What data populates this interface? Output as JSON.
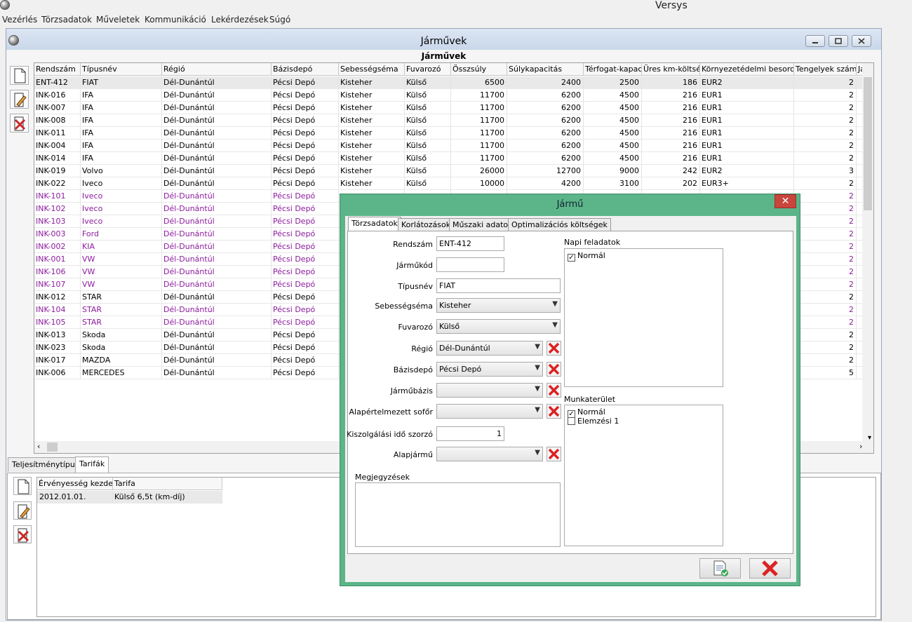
{
  "app": {
    "title": "Versys"
  },
  "menu": [
    "Vezérlés",
    "Törzsadatok",
    "Műveletek",
    "Kommunikáció",
    "Lekérdezések",
    "Súgó"
  ],
  "window": {
    "title": "Járművek",
    "heading": "Járművek"
  },
  "grid": {
    "columns": [
      "Rendszám",
      "Típusnév",
      "Régió",
      "Bázisdepó",
      "Sebességséma",
      "Fuvarozó",
      "Összsúly",
      "Súlykapacitás",
      "Térfogat-kapacit",
      "Üres km-költség",
      "Környezetédelmi besorolás",
      "Tengelyek száma",
      "Ja"
    ],
    "rows": [
      [
        "ENT-412",
        "FIAT",
        "Dél-Dunántúl",
        "Pécsi Depó",
        "Kisteher",
        "Külső",
        "6500",
        "2400",
        "2500",
        "186",
        "EUR2",
        "2"
      ],
      [
        "INK-016",
        "IFA",
        "Dél-Dunántúl",
        "Pécsi Depó",
        "Kisteher",
        "Külső",
        "11700",
        "6200",
        "4500",
        "216",
        "EUR1",
        "2"
      ],
      [
        "INK-007",
        "IFA",
        "Dél-Dunántúl",
        "Pécsi Depó",
        "Kisteher",
        "Külső",
        "11700",
        "6200",
        "4500",
        "216",
        "EUR1",
        "2"
      ],
      [
        "INK-008",
        "IFA",
        "Dél-Dunántúl",
        "Pécsi Depó",
        "Kisteher",
        "Külső",
        "11700",
        "6200",
        "4500",
        "216",
        "EUR1",
        "2"
      ],
      [
        "INK-011",
        "IFA",
        "Dél-Dunántúl",
        "Pécsi Depó",
        "Kisteher",
        "Külső",
        "11700",
        "6200",
        "4500",
        "216",
        "EUR1",
        "2"
      ],
      [
        "INK-004",
        "IFA",
        "Dél-Dunántúl",
        "Pécsi Depó",
        "Kisteher",
        "Külső",
        "11700",
        "6200",
        "4500",
        "216",
        "EUR1",
        "2"
      ],
      [
        "INK-014",
        "IFA",
        "Dél-Dunántúl",
        "Pécsi Depó",
        "Kisteher",
        "Külső",
        "11700",
        "6200",
        "4500",
        "216",
        "EUR1",
        "2"
      ],
      [
        "INK-019",
        "Volvo",
        "Dél-Dunántúl",
        "Pécsi Depó",
        "Kisteher",
        "Külső",
        "26000",
        "12700",
        "9000",
        "242",
        "EUR2",
        "3"
      ],
      [
        "INK-022",
        "Iveco",
        "Dél-Dunántúl",
        "Pécsi Depó",
        "Kisteher",
        "Külső",
        "10000",
        "4200",
        "3100",
        "202",
        "EUR3+",
        "2"
      ],
      [
        "INK-101",
        "Iveco",
        "Dél-Dunántúl",
        "Pécsi Depó",
        "",
        "",
        "",
        "",
        "",
        "",
        "",
        "2"
      ],
      [
        "INK-102",
        "Iveco",
        "Dél-Dunántúl",
        "Pécsi Depó",
        "",
        "",
        "",
        "",
        "",
        "",
        "",
        "2"
      ],
      [
        "INK-103",
        "Iveco",
        "Dél-Dunántúl",
        "Pécsi Depó",
        "",
        "",
        "",
        "",
        "",
        "",
        "",
        "2"
      ],
      [
        "INK-003",
        "Ford",
        "Dél-Dunántúl",
        "Pécsi Depó",
        "",
        "",
        "",
        "",
        "",
        "",
        "",
        "2"
      ],
      [
        "INK-002",
        "KIA",
        "Dél-Dunántúl",
        "Pécsi Depó",
        "",
        "",
        "",
        "",
        "",
        "",
        "",
        "2"
      ],
      [
        "INK-001",
        "VW",
        "Dél-Dunántúl",
        "Pécsi Depó",
        "",
        "",
        "",
        "",
        "",
        "",
        "",
        "2"
      ],
      [
        "INK-106",
        "VW",
        "Dél-Dunántúl",
        "Pécsi Depó",
        "",
        "",
        "",
        "",
        "",
        "",
        "",
        "2"
      ],
      [
        "INK-107",
        "VW",
        "Dél-Dunántúl",
        "Pécsi Depó",
        "",
        "",
        "",
        "",
        "",
        "",
        "",
        "2"
      ],
      [
        "INK-012",
        "STAR",
        "Dél-Dunántúl",
        "Pécsi Depó",
        "",
        "",
        "",
        "",
        "",
        "",
        "",
        "2"
      ],
      [
        "INK-104",
        "STAR",
        "Dél-Dunántúl",
        "Pécsi Depó",
        "",
        "",
        "",
        "",
        "",
        "",
        "",
        "2"
      ],
      [
        "INK-105",
        "STAR",
        "Dél-Dunántúl",
        "Pécsi Depó",
        "",
        "",
        "",
        "",
        "",
        "",
        "",
        "2"
      ],
      [
        "INK-013",
        "Skoda",
        "Dél-Dunántúl",
        "Pécsi Depó",
        "",
        "",
        "",
        "",
        "",
        "",
        "",
        "2"
      ],
      [
        "INK-023",
        "Skoda",
        "Dél-Dunántúl",
        "Pécsi Depó",
        "",
        "",
        "",
        "",
        "",
        "",
        "",
        "2"
      ],
      [
        "INK-017",
        "MAZDA",
        "Dél-Dunántúl",
        "Pécsi Depó",
        "",
        "",
        "",
        "",
        "",
        "",
        "",
        "2"
      ],
      [
        "INK-006",
        "MERCEDES",
        "Dél-Dunántúl",
        "Pécsi Depó",
        "",
        "",
        "",
        "",
        "",
        "",
        "",
        "5"
      ]
    ],
    "purple_rows": [
      "INK-101",
      "INK-102",
      "INK-103",
      "INK-003",
      "INK-002",
      "INK-001",
      "INK-106",
      "INK-107",
      "INK-104",
      "INK-105"
    ],
    "selected_row": "ENT-412"
  },
  "bottom_tabs": [
    "Teljesítménytípus",
    "Tarifák"
  ],
  "tariffs": {
    "columns": [
      "Érvényesség kezdete",
      "Tarifa"
    ],
    "rows": [
      [
        "2012.01.01.",
        "Külső 6,5t (km-díj)"
      ]
    ]
  },
  "dialog": {
    "title": "Jármű",
    "close_label": "✕",
    "tabs": [
      "Törzsadatok",
      "Korlátozások",
      "Műszaki adatok",
      "Optimalizációs költségek"
    ],
    "labels": {
      "rendszam": "Rendszám",
      "jarmukod": "Járműkód",
      "tipusnev": "Típusnév",
      "sebessegsema": "Sebességséma",
      "fuvarozo": "Fuvarozó",
      "regio": "Régió",
      "bazisdepo": "Bázisdepó",
      "jarmubazis": "Járműbázis",
      "sofor": "Alapértelmezett sofőr",
      "szorzo": "Kiszolgálási idő szorzó",
      "alapjarmu": "Alapjármű",
      "megjegyzesek": "Megjegyzések",
      "napi_feladatok": "Napi feladatok",
      "munkaterulet": "Munkaterület"
    },
    "values": {
      "rendszam": "ENT-412",
      "jarmukod": "",
      "tipusnev": "FIAT",
      "sebessegsema": "Kisteher",
      "fuvarozo": "Külső",
      "regio": "Dél-Dunántúl",
      "bazisdepo": "Pécsi Depó",
      "jarmubazis": "",
      "sofor": "",
      "szorzo": "1",
      "alapjarmu": ""
    },
    "napi_feladatok": [
      {
        "label": "Normál",
        "checked": true
      }
    ],
    "munkaterulet": [
      {
        "label": "Normál",
        "checked": true
      },
      {
        "label": "Elemzési 1",
        "checked": false
      }
    ]
  },
  "colors": {
    "dialog_frame": "#5cb589",
    "close_red": "#c9463d",
    "purple_text": "#8b1c9c"
  }
}
